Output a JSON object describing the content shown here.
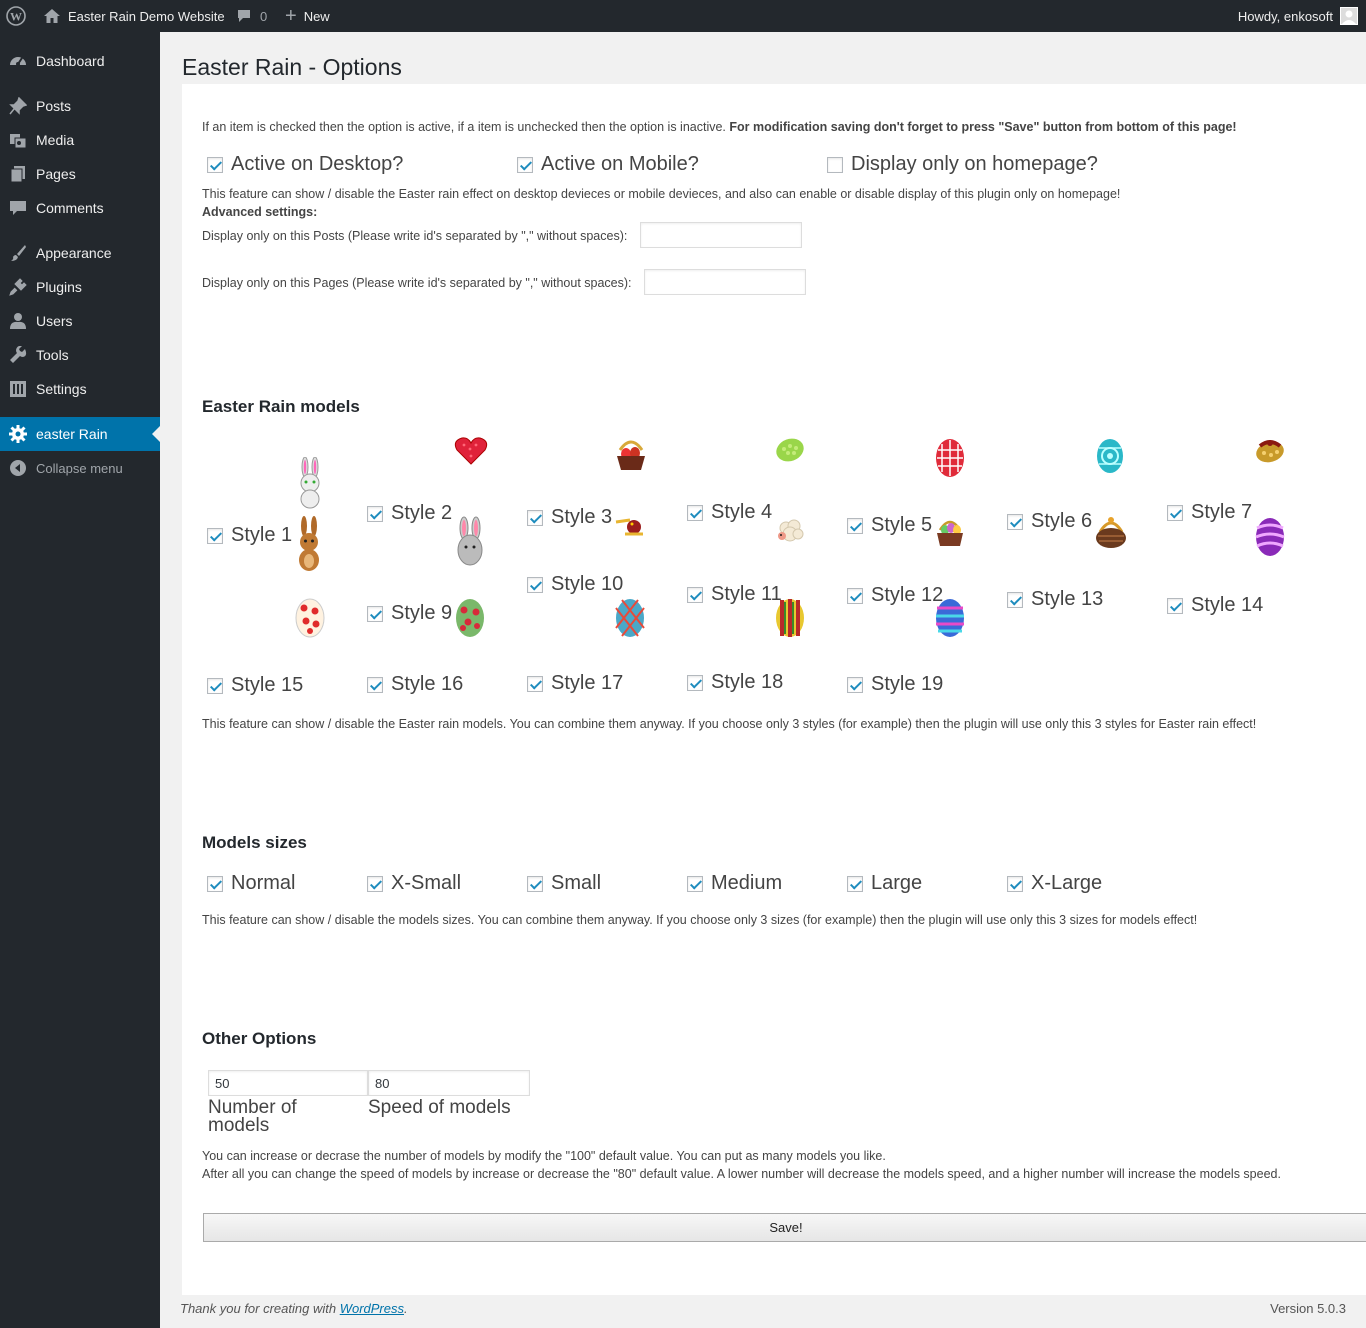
{
  "adminbar": {
    "site_name": "Easter Rain Demo Website",
    "comments_count": "0",
    "new_label": "New",
    "howdy": "Howdy, enkosoft"
  },
  "sidebar": {
    "items": [
      {
        "label": "Dashboard",
        "icon": "dashboard-icon"
      },
      {
        "label": "Posts",
        "icon": "pin-icon"
      },
      {
        "label": "Media",
        "icon": "media-icon"
      },
      {
        "label": "Pages",
        "icon": "pages-icon"
      },
      {
        "label": "Comments",
        "icon": "comments-icon"
      },
      {
        "label": "Appearance",
        "icon": "brush-icon"
      },
      {
        "label": "Plugins",
        "icon": "plug-icon"
      },
      {
        "label": "Users",
        "icon": "user-icon"
      },
      {
        "label": "Tools",
        "icon": "wrench-icon"
      },
      {
        "label": "Settings",
        "icon": "settings-icon"
      },
      {
        "label": "easter Rain",
        "icon": "gear-icon"
      }
    ],
    "collapse": "Collapse menu"
  },
  "page": {
    "title": "Easter Rain - Options",
    "intro_normal": "If an item is checked then the option is active, if a item is unchecked then the option is inactive. ",
    "intro_bold": "For modification saving don't forget to press \"Save\" button from bottom of this page!",
    "display_options": [
      {
        "label": "Active on Desktop?",
        "checked": true
      },
      {
        "label": "Active on Mobile?",
        "checked": true
      },
      {
        "label": "Display only on homepage?",
        "checked": false
      }
    ],
    "display_desc": "This feature can show / disable the Easter rain effect on desktop devieces or mobile devieces, and also can enable or disable display of this plugin only on homepage!",
    "advanced_label": "Advanced settings:",
    "posts_label": "Display only on this Posts (Please write id's separated by \",\" without spaces):",
    "posts_value": "",
    "pages_label": "Display only on this Pages (Please write id's separated by \",\" without spaces):",
    "pages_value": "",
    "models_heading": "Easter Rain models",
    "styles": [
      {
        "label": "Style 1",
        "checked": true,
        "icon": "bunny-icon"
      },
      {
        "label": "Style 2",
        "checked": true,
        "icon": "heart-icon"
      },
      {
        "label": "Style 3",
        "checked": true,
        "icon": "basket-icon"
      },
      {
        "label": "Style 4",
        "checked": true,
        "icon": "green-egg-icon"
      },
      {
        "label": "Style 5",
        "checked": true,
        "icon": "red-egg-icon"
      },
      {
        "label": "Style 6",
        "checked": true,
        "icon": "teal-egg-icon"
      },
      {
        "label": "Style 7",
        "checked": true,
        "icon": "gold-egg-icon"
      },
      {
        "label": "",
        "checked": false,
        "icon": "brown-bunny-icon"
      },
      {
        "label": "Style 9",
        "checked": true,
        "icon": "egg-bunny-icon"
      },
      {
        "label": "Style 10",
        "checked": true,
        "icon": "chick-icon"
      },
      {
        "label": "Style 11",
        "checked": true,
        "icon": "lamb-icon"
      },
      {
        "label": "Style 12",
        "checked": true,
        "icon": "egg-basket-icon"
      },
      {
        "label": "Style 13",
        "checked": true,
        "icon": "wicker-basket-icon"
      },
      {
        "label": "Style 14",
        "checked": true,
        "icon": "purple-striped-egg-icon"
      },
      {
        "label": "Style 15",
        "checked": true,
        "icon": "dotted-egg-icon"
      },
      {
        "label": "Style 16",
        "checked": true,
        "icon": "flower-egg-icon"
      },
      {
        "label": "Style 17",
        "checked": true,
        "icon": "diamond-egg-icon"
      },
      {
        "label": "Style 18",
        "checked": true,
        "icon": "striped-egg-icon"
      },
      {
        "label": "Style 19",
        "checked": true,
        "icon": "blue-egg-icon"
      }
    ],
    "models_desc": "This feature can show / disable the Easter rain models. You can combine them anyway. If you choose only 3 styles (for example) then the plugin will use only this 3 styles for Easter rain effect!",
    "sizes_heading": "Models sizes",
    "sizes": [
      {
        "label": "Normal",
        "checked": true
      },
      {
        "label": "X-Small",
        "checked": true
      },
      {
        "label": "Small",
        "checked": true
      },
      {
        "label": "Medium",
        "checked": true
      },
      {
        "label": "Large",
        "checked": true
      },
      {
        "label": "X-Large",
        "checked": true
      }
    ],
    "sizes_desc": "This feature can show / disable the models sizes. You can combine them anyway. If you choose only 3 sizes (for example) then the plugin will use only this 3 sizes for models effect!",
    "other_heading": "Other Options",
    "number_value": "50",
    "number_label": "Number of models",
    "speed_value": "80",
    "speed_label": "Speed of models",
    "other_desc_1": "You can increase or decrase the number of models by modify the \"100\" default value. You can put as many models you like.",
    "other_desc_2": "After all you can change the speed of models by increase or decrease the \"80\" default value. A lower number will decrease the models speed, and a higher number will increase the models speed.",
    "save_label": "Save!"
  },
  "footer": {
    "thanks_prefix": "Thank you for creating with ",
    "wp_link": "WordPress",
    "thanks_suffix": ".",
    "version": "Version 5.0.3"
  },
  "colors": {
    "adminbar_bg": "#23282d",
    "active_menu": "#0073aa",
    "checkbox_check": "#1e8cbe"
  }
}
